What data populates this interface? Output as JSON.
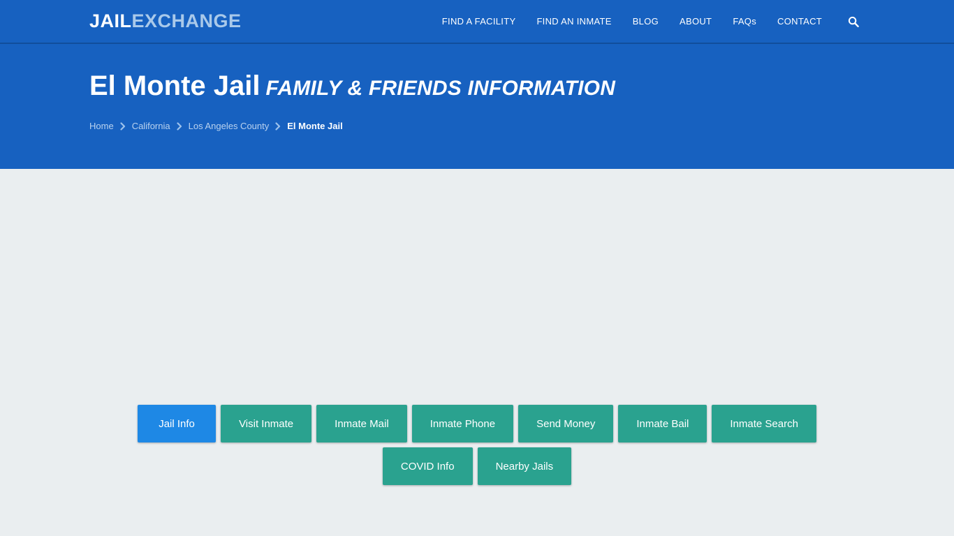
{
  "site": {
    "logo_primary": "JAIL",
    "logo_secondary": "EXCHANGE"
  },
  "nav": {
    "items": [
      {
        "label": "FIND A FACILITY",
        "name": "nav-item-find-a-facility"
      },
      {
        "label": "FIND AN INMATE",
        "name": "nav-item-find-an-inmate"
      },
      {
        "label": "BLOG",
        "name": "nav-item-blog"
      },
      {
        "label": "ABOUT",
        "name": "nav-item-about"
      },
      {
        "label": "FAQs",
        "name": "nav-item-faqs"
      },
      {
        "label": "CONTACT",
        "name": "nav-item-contact"
      }
    ],
    "search_icon": "search-icon"
  },
  "hero": {
    "title": "El Monte Jail",
    "subtitle": "FAMILY & FRIENDS INFORMATION",
    "breadcrumb": [
      {
        "label": "Home",
        "current": false
      },
      {
        "label": "California",
        "current": false
      },
      {
        "label": "Los Angeles County",
        "current": false
      },
      {
        "label": "El Monte Jail",
        "current": true
      }
    ],
    "separator_icon": "chevron-right-icon"
  },
  "tabs": {
    "row1": [
      {
        "label": "Jail Info",
        "active": true
      },
      {
        "label": "Visit Inmate",
        "active": false
      },
      {
        "label": "Inmate Mail",
        "active": false
      },
      {
        "label": "Inmate Phone",
        "active": false
      },
      {
        "label": "Send Money",
        "active": false
      },
      {
        "label": "Inmate Bail",
        "active": false
      },
      {
        "label": "Inmate Search",
        "active": false
      }
    ],
    "row2": [
      {
        "label": "COVID Info",
        "active": false
      },
      {
        "label": "Nearby Jails",
        "active": false
      }
    ]
  },
  "colors": {
    "header_blue": "#1761c0",
    "header_border": "#114e9c",
    "body_background": "#eaeef0",
    "teal_button": "#2aa28f",
    "active_button": "#1e88e5",
    "logo_secondary_color": "#a9c9ea",
    "breadcrumb_link": "#b9d2ef"
  }
}
